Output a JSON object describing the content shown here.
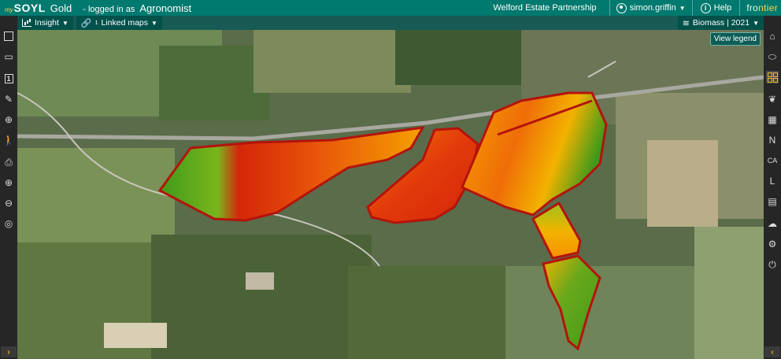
{
  "header": {
    "logo_prefix": "my",
    "logo_name": "SOYL",
    "logo_tier": "Gold",
    "logged_in_prefix": "- logged in as",
    "logged_in_role": "Agronomist",
    "estate": "Welford Estate Partnership",
    "user": "simon.griffin",
    "help_label": "Help",
    "brand_part1": "fro",
    "brand_part2": "ntier"
  },
  "toolbar": {
    "insight_label": "Insight",
    "linked_maps_label": "Linked maps",
    "linked_maps_count": "1",
    "layer_label": "Biomass | 2021"
  },
  "map": {
    "view_legend_label": "View legend"
  },
  "left_tools": [
    {
      "name": "field-boundary-tool",
      "icon": "field-map-icon"
    },
    {
      "name": "display-tool",
      "icon": "projector-icon"
    },
    {
      "name": "single-view-tool",
      "icon": "single-view-icon",
      "label": "1"
    },
    {
      "name": "edit-tool",
      "icon": "pencil-icon"
    },
    {
      "name": "locate-tool",
      "icon": "crosshair-icon"
    },
    {
      "name": "walk-tool",
      "icon": "walking-person-icon"
    },
    {
      "name": "print-tool",
      "icon": "printer-icon"
    },
    {
      "name": "zoom-in-tool",
      "icon": "zoom-in-icon"
    },
    {
      "name": "zoom-out-tool",
      "icon": "zoom-out-icon"
    },
    {
      "name": "zoom-extent-tool",
      "icon": "zoom-extent-icon"
    }
  ],
  "right_tools": [
    {
      "name": "home",
      "icon": "home-icon"
    },
    {
      "name": "fields",
      "icon": "field-outline-icon"
    },
    {
      "name": "grid-view",
      "icon": "grid-icon"
    },
    {
      "name": "crops",
      "icon": "wheat-icon"
    },
    {
      "name": "soil-analysis",
      "icon": "calculator-icon"
    },
    {
      "name": "nitrogen",
      "icon": "nitrogen-doc-icon",
      "label": "N"
    },
    {
      "name": "calcium",
      "icon": "calcium-doc-icon",
      "label": "CA"
    },
    {
      "name": "lime",
      "icon": "lime-doc-icon",
      "label": "L"
    },
    {
      "name": "prescriptions",
      "icon": "prescription-doc-icon"
    },
    {
      "name": "cloud",
      "icon": "cloud-icon"
    },
    {
      "name": "settings",
      "icon": "gear-icon"
    },
    {
      "name": "logout",
      "icon": "power-icon"
    }
  ],
  "colors": {
    "header_bg": "#00796e",
    "toolbar_bg": "#262626",
    "field_outline": "#b3140c",
    "biomass_low": "#d4260a",
    "biomass_mid": "#f5a000",
    "biomass_high": "#3f9a1a",
    "accent": "#e5b72f"
  }
}
